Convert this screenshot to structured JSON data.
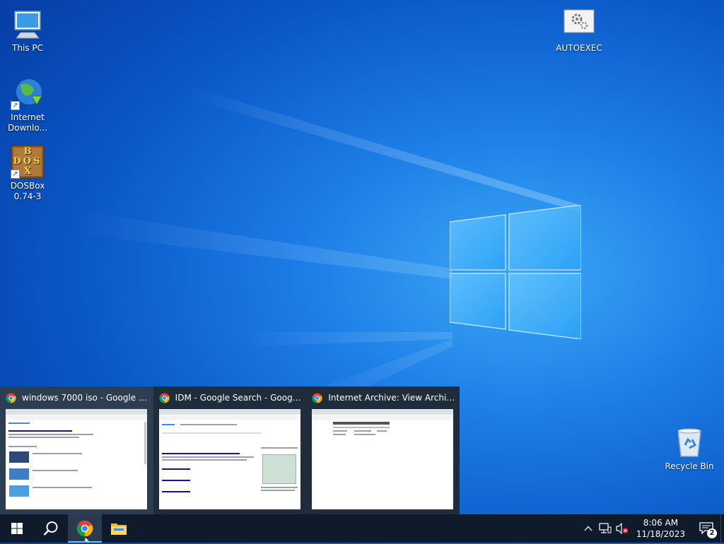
{
  "desktop": {
    "icons": [
      {
        "label": "This PC",
        "icon": "computer-icon"
      },
      {
        "label": "Internet Downlo...",
        "icon": "idm-globe-icon"
      },
      {
        "label": "DOSBox 0.74-3",
        "icon": "dosbox-icon",
        "logo_text": [
          "B",
          "D",
          "O",
          "S",
          "X"
        ]
      },
      {
        "label": "AUTOEXEC",
        "icon": "settings-file-icon"
      },
      {
        "label": "Recycle Bin",
        "icon": "recycle-bin-icon"
      }
    ]
  },
  "taskbar": {
    "items": [
      {
        "name": "start",
        "icon": "windows-icon"
      },
      {
        "name": "search",
        "icon": "search-icon"
      },
      {
        "name": "chrome",
        "icon": "chrome-icon",
        "active": true
      },
      {
        "name": "file-explorer",
        "icon": "folder-icon"
      }
    ],
    "tray": {
      "time": "8:06 AM",
      "date": "11/18/2023",
      "notification_count": "2"
    }
  },
  "thumbnails": [
    {
      "title": "windows 7000 iso - Google Sear...",
      "hover": true
    },
    {
      "title": "IDM - Google Search - Google ...",
      "hover": false
    },
    {
      "title": "Internet Archive: View Archive -...",
      "hover": false
    }
  ],
  "colors": {
    "taskbar": "#0f1b2a",
    "thumb_panel": "#1e2c3c",
    "accent": "#76b9ed"
  }
}
